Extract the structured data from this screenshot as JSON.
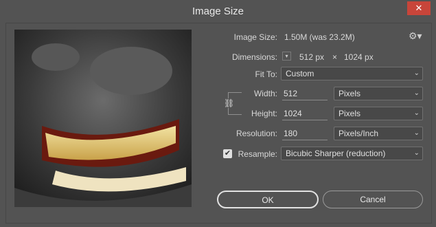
{
  "window": {
    "title": "Image Size",
    "close_icon": "close-icon"
  },
  "info": {
    "image_size_label": "Image Size:",
    "image_size_value": "1.50M (was 23.2M)",
    "dimensions_label": "Dimensions:",
    "dimensions_width": "512 px",
    "dimensions_x": "×",
    "dimensions_height": "1024 px"
  },
  "fit_to": {
    "label": "Fit To:",
    "value": "Custom"
  },
  "width": {
    "label": "Width:",
    "value": "512",
    "unit": "Pixels"
  },
  "height": {
    "label": "Height:",
    "value": "1024",
    "unit": "Pixels"
  },
  "resolution": {
    "label": "Resolution:",
    "value": "180",
    "unit": "Pixels/Inch"
  },
  "resample": {
    "label": "Resample:",
    "checked": true,
    "value": "Bicubic Sharper (reduction)"
  },
  "buttons": {
    "ok": "OK",
    "cancel": "Cancel"
  },
  "colors": {
    "close": "#c8453a",
    "background": "#535353"
  }
}
